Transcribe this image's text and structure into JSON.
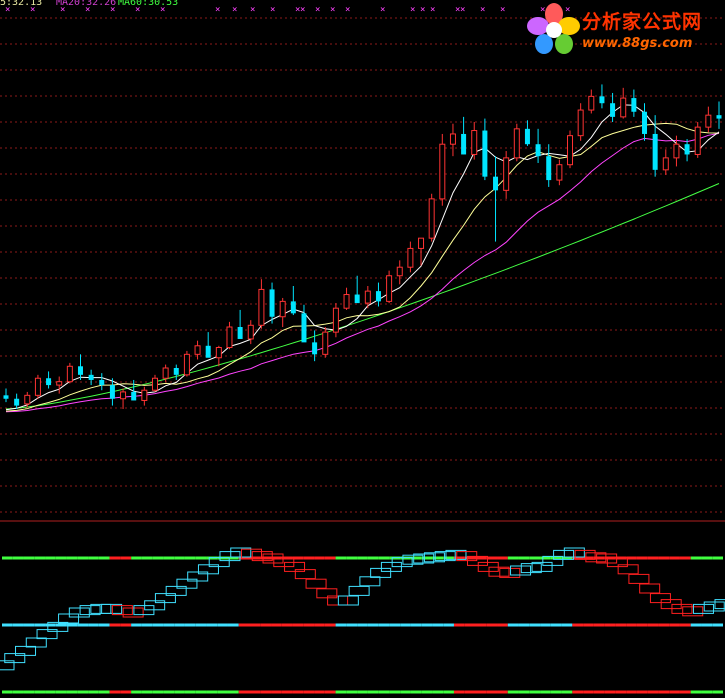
{
  "header": {
    "ma_labels": [
      "5:32.13",
      "MA20:32.26",
      "MA60:30.53"
    ],
    "ma_colors": [
      "#e8e8a0",
      "#d040d0",
      "#40ff40"
    ]
  },
  "logo": {
    "name_cn": "分析家公式网",
    "url": "www.88gs.com"
  },
  "colors": {
    "up": "#ff3333",
    "down": "#00e5ff",
    "grid": "#8b1a1a",
    "ma5": "#ffffff",
    "ma10": "#ffff99",
    "ma20": "#ff44ff",
    "ma60": "#44ff44",
    "signal_buy": "#40ff40",
    "signal_sell": "#ff2020",
    "signal_cyan": "#40e0ff",
    "marker": "#ff44ff"
  },
  "chart_data": [
    {
      "type": "candlestick",
      "title": "",
      "ylim": [
        18,
        42
      ],
      "candles": [
        [
          21.2,
          21.6,
          20.8,
          21.0
        ],
        [
          21.0,
          21.3,
          20.4,
          20.6
        ],
        [
          20.7,
          21.4,
          20.5,
          21.2
        ],
        [
          21.2,
          22.4,
          21.0,
          22.2
        ],
        [
          22.2,
          22.6,
          21.6,
          21.8
        ],
        [
          21.8,
          22.3,
          21.3,
          22.0
        ],
        [
          22.0,
          23.1,
          21.9,
          22.9
        ],
        [
          22.9,
          23.6,
          22.1,
          22.4
        ],
        [
          22.4,
          22.7,
          21.8,
          22.1
        ],
        [
          22.1,
          22.5,
          21.5,
          21.8
        ],
        [
          21.8,
          22.2,
          20.6,
          21.0
        ],
        [
          21.0,
          21.6,
          20.4,
          21.4
        ],
        [
          21.4,
          22.1,
          20.9,
          20.9
        ],
        [
          20.9,
          21.7,
          20.6,
          21.5
        ],
        [
          21.5,
          22.4,
          21.4,
          22.2
        ],
        [
          22.2,
          23.0,
          22.0,
          22.8
        ],
        [
          22.8,
          23.0,
          22.1,
          22.4
        ],
        [
          22.4,
          23.8,
          22.3,
          23.6
        ],
        [
          23.6,
          24.4,
          23.3,
          24.1
        ],
        [
          24.1,
          24.9,
          23.8,
          23.4
        ],
        [
          23.4,
          24.1,
          22.9,
          24.0
        ],
        [
          24.0,
          25.5,
          23.9,
          25.2
        ],
        [
          25.2,
          26.2,
          24.8,
          24.5
        ],
        [
          24.5,
          25.6,
          24.2,
          25.3
        ],
        [
          25.3,
          28.0,
          25.1,
          27.4
        ],
        [
          27.4,
          27.8,
          25.4,
          25.8
        ],
        [
          25.8,
          26.9,
          25.2,
          26.7
        ],
        [
          26.7,
          27.6,
          25.9,
          26.0
        ],
        [
          26.0,
          26.5,
          24.5,
          24.3
        ],
        [
          24.3,
          25.0,
          23.2,
          23.6
        ],
        [
          23.6,
          25.2,
          23.4,
          24.9
        ],
        [
          24.9,
          26.6,
          24.6,
          26.3
        ],
        [
          26.3,
          27.5,
          26.2,
          27.1
        ],
        [
          27.1,
          28.2,
          26.7,
          26.6
        ],
        [
          26.6,
          27.6,
          26.3,
          27.3
        ],
        [
          27.3,
          27.8,
          26.4,
          26.7
        ],
        [
          26.7,
          28.5,
          26.6,
          28.2
        ],
        [
          28.2,
          29.1,
          27.7,
          28.7
        ],
        [
          28.7,
          30.2,
          28.4,
          29.8
        ],
        [
          29.8,
          30.1,
          28.8,
          30.4
        ],
        [
          30.4,
          33.0,
          30.2,
          32.7
        ],
        [
          32.7,
          36.5,
          32.3,
          35.9
        ],
        [
          35.9,
          37.1,
          35.2,
          36.5
        ],
        [
          36.5,
          37.5,
          35.3,
          35.3
        ],
        [
          35.3,
          37.2,
          35.0,
          36.7
        ],
        [
          36.7,
          37.4,
          33.8,
          34.0
        ],
        [
          34.0,
          35.2,
          30.2,
          33.2
        ],
        [
          33.2,
          35.5,
          32.7,
          35.1
        ],
        [
          35.1,
          37.1,
          34.9,
          36.8
        ],
        [
          36.8,
          37.3,
          35.8,
          35.9
        ],
        [
          35.9,
          36.8,
          34.8,
          35.2
        ],
        [
          35.2,
          35.9,
          33.4,
          33.8
        ],
        [
          33.8,
          35.0,
          33.5,
          34.7
        ],
        [
          34.7,
          36.7,
          34.5,
          36.4
        ],
        [
          36.4,
          38.3,
          36.1,
          37.9
        ],
        [
          37.9,
          39.1,
          37.7,
          38.7
        ],
        [
          38.7,
          39.4,
          38.0,
          38.3
        ],
        [
          38.3,
          38.9,
          37.2,
          37.5
        ],
        [
          37.5,
          39.2,
          37.4,
          38.6
        ],
        [
          38.6,
          39.1,
          37.5,
          37.8
        ],
        [
          37.8,
          38.3,
          36.1,
          36.5
        ],
        [
          36.5,
          37.6,
          34.0,
          34.4
        ],
        [
          34.4,
          35.6,
          34.1,
          35.1
        ],
        [
          35.1,
          36.4,
          34.6,
          35.9
        ],
        [
          35.9,
          36.2,
          34.9,
          35.3
        ],
        [
          35.3,
          37.2,
          35.1,
          36.9
        ],
        [
          36.9,
          38.1,
          36.6,
          37.6
        ],
        [
          37.6,
          38.4,
          36.8,
          37.4
        ]
      ],
      "ma_lines": [
        "MA5",
        "MA10",
        "MA20",
        "MA60"
      ]
    },
    {
      "type": "signal",
      "title": "",
      "levels": [
        "top",
        "middle",
        "bottom"
      ],
      "oscillator": [
        0.06,
        0.12,
        0.18,
        0.25,
        0.32,
        0.38,
        0.45,
        0.5,
        0.52,
        0.53,
        0.53,
        0.52,
        0.5,
        0.52,
        0.56,
        0.62,
        0.68,
        0.74,
        0.8,
        0.86,
        0.92,
        0.97,
        1.0,
        0.99,
        0.97,
        0.95,
        0.92,
        0.88,
        0.82,
        0.74,
        0.66,
        0.6,
        0.6,
        0.68,
        0.76,
        0.83,
        0.88,
        0.92,
        0.94,
        0.95,
        0.96,
        0.97,
        0.98,
        0.97,
        0.93,
        0.88,
        0.84,
        0.83,
        0.85,
        0.87,
        0.88,
        0.93,
        0.98,
        1.0,
        0.98,
        0.96,
        0.95,
        0.92,
        0.86,
        0.78,
        0.7,
        0.62,
        0.57,
        0.53,
        0.51,
        0.53,
        0.55,
        0.57
      ]
    }
  ]
}
